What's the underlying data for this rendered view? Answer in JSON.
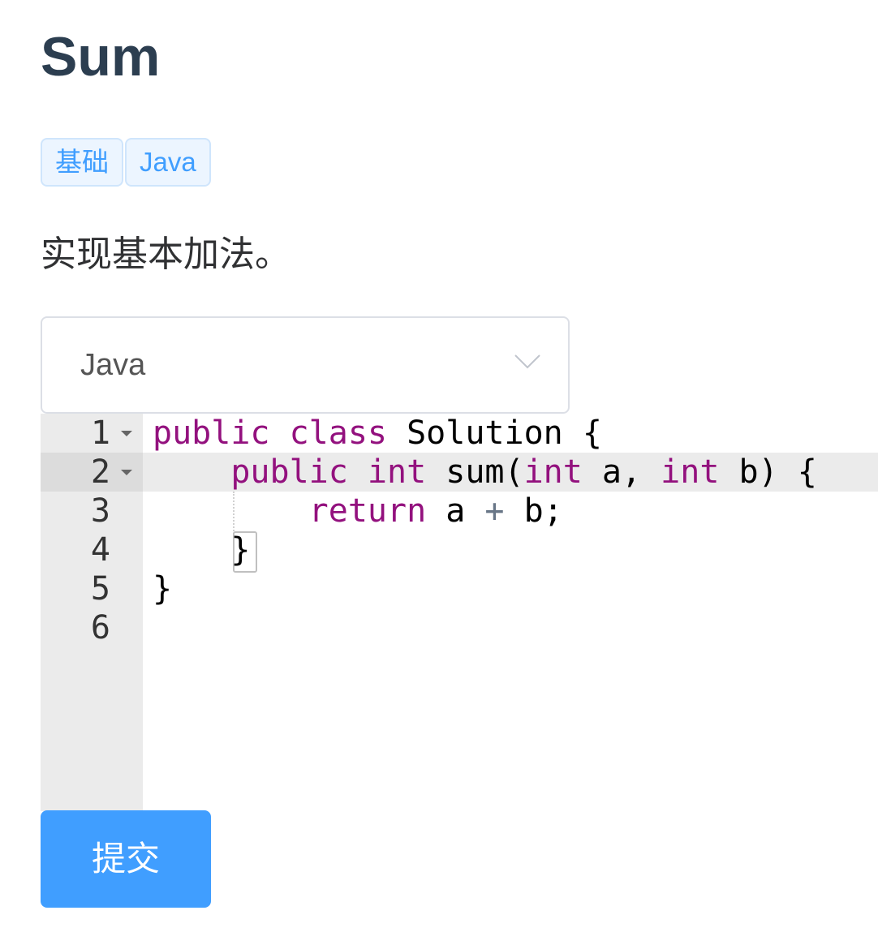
{
  "problem": {
    "title": "Sum",
    "tags": [
      "基础",
      "Java"
    ],
    "description": "实现基本加法。"
  },
  "language_select": {
    "value": "Java",
    "icon": "chevron-down-icon"
  },
  "editor": {
    "line_numbers": [
      "1",
      "2",
      "3",
      "4",
      "5",
      "6"
    ],
    "active_line": 2,
    "code": {
      "line1": {
        "kw1": "public",
        "kw2": "class",
        "rest": " Solution {"
      },
      "line2": {
        "kw1": "public",
        "kw2": "int",
        "mid": " sum(",
        "kw3": "int",
        "mid2": " a, ",
        "kw4": "int",
        "rest": " b) {"
      },
      "line3": {
        "kw1": "return",
        "a": " a ",
        "op": "+",
        "rest": " b;"
      },
      "line4": {
        "text": "}"
      },
      "line5": {
        "text": "}"
      },
      "line6": {
        "text": ""
      }
    }
  },
  "submit_button": {
    "label": "提交"
  },
  "colors": {
    "title": "#2c3e50",
    "tag_text": "#409eff",
    "tag_bg": "#ecf5ff",
    "keyword": "#93117e",
    "button_bg": "#409eff",
    "gutter_bg": "#ebebeb"
  }
}
